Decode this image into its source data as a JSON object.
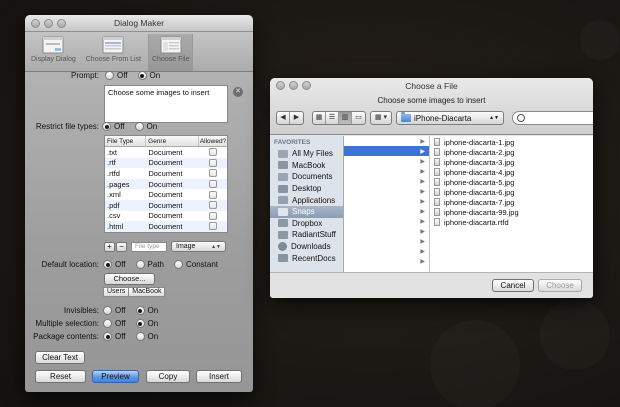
{
  "dialog_maker": {
    "title": "Dialog Maker",
    "toolbar": [
      "Display Dialog",
      "Choose From List",
      "Choose File"
    ],
    "prompt": {
      "label": "Prompt:",
      "off": "Off",
      "on": "On",
      "text": "Choose some images to insert"
    },
    "restrict": {
      "label": "Restrict file types:",
      "off": "Off",
      "on": "On"
    },
    "file_types": {
      "headers": [
        "File Type",
        "Genre",
        "Allowed?"
      ],
      "rows": [
        [
          ".txt",
          "Document"
        ],
        [
          ".rtf",
          "Document"
        ],
        [
          ".rtfd",
          "Document"
        ],
        [
          ".pages",
          "Document"
        ],
        [
          ".xml",
          "Document"
        ],
        [
          ".pdf",
          "Document"
        ],
        [
          ".csv",
          "Document"
        ],
        [
          ".html",
          "Document"
        ]
      ],
      "add": "+",
      "remove": "−",
      "placeholder": "File type",
      "genre_select": "Image"
    },
    "default_location": {
      "label": "Default location:",
      "off": "Off",
      "path": "Path",
      "constant": "Constant",
      "choose": "Choose...",
      "path_parts": [
        "Users",
        "MacBook"
      ]
    },
    "invisibles": {
      "label": "Invisibles:",
      "off": "Off",
      "on": "On"
    },
    "multiple": {
      "label": "Multiple selection:",
      "off": "Off",
      "on": "On"
    },
    "package": {
      "label": "Package contents:",
      "off": "Off",
      "on": "On"
    },
    "buttons": {
      "clear_text": "Clear Text",
      "reset": "Reset",
      "preview": "Preview",
      "copy": "Copy",
      "insert": "Insert"
    }
  },
  "choose_file": {
    "title": "Choose a File",
    "message": "Choose some images to insert",
    "location": "iPhone-Diacarta",
    "sidebar_header": "FAVORITES",
    "sidebar": [
      "All My Files",
      "MacBook",
      "Documents",
      "Desktop",
      "Applications",
      "Snaps",
      "Dropbox",
      "RadiantStuff",
      "Downloads",
      "RecentDocs"
    ],
    "files": [
      "iphone-diacarta-1.jpg",
      "iphone-diacarta-2.jpg",
      "iphone-diacarta-3.jpg",
      "iphone-diacarta-4.jpg",
      "iphone-diacarta-5.jpg",
      "iphone-diacarta-6.jpg",
      "iphone-diacarta-7.jpg",
      "iphone-diacarta-99.jpg",
      "iphone-diacarta.rtfd"
    ],
    "cancel": "Cancel",
    "choose": "Choose"
  }
}
